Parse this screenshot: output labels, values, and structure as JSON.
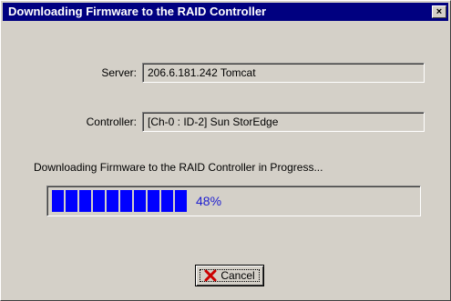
{
  "window": {
    "title": "Downloading Firmware to the RAID Controller",
    "close_glyph": "×"
  },
  "server": {
    "label": "Server:",
    "value": "206.6.181.242 Tomcat"
  },
  "controller": {
    "label": "Controller:",
    "value": "[Ch-0 : ID-2] Sun StorEdge"
  },
  "progress": {
    "caption": "Downloading Firmware to the RAID Controller in Progress...",
    "percent_text": "48%",
    "fraction": 0.48,
    "bar_color": "#0000ff"
  },
  "buttons": {
    "cancel_label": "Cancel",
    "cancel_icon": "red-x-icon"
  }
}
